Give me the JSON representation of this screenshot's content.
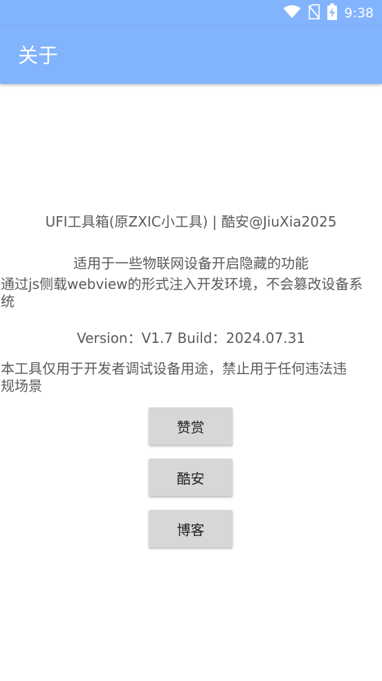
{
  "status_bar": {
    "time": "9:38",
    "icons": [
      "wifi-icon",
      "no-sim-icon",
      "battery-charging-icon"
    ]
  },
  "app_bar": {
    "title": "关于"
  },
  "about": {
    "title_line": "UFI工具箱(原ZXIC小工具)  |  酷安@JiuXia2025",
    "desc_line1": "适用于一些物联网设备开启隐藏的功能",
    "desc_line2": "通过js侧载webview的形式注入开发环境，不会篡改设备系",
    "desc_line3": "统",
    "version_line": "Version：V1.7   Build：2024.07.31",
    "disclaimer_line1": "本工具仅用于开发者调试设备用途，禁止用于任何违法违",
    "disclaimer_line2": "规场景"
  },
  "buttons": {
    "reward": "赞赏",
    "coolapk": "酷安",
    "blog": "博客"
  },
  "colors": {
    "accent": "#82b3fd",
    "text": "#5a5a5a",
    "button_bg": "#d7d7d7"
  }
}
